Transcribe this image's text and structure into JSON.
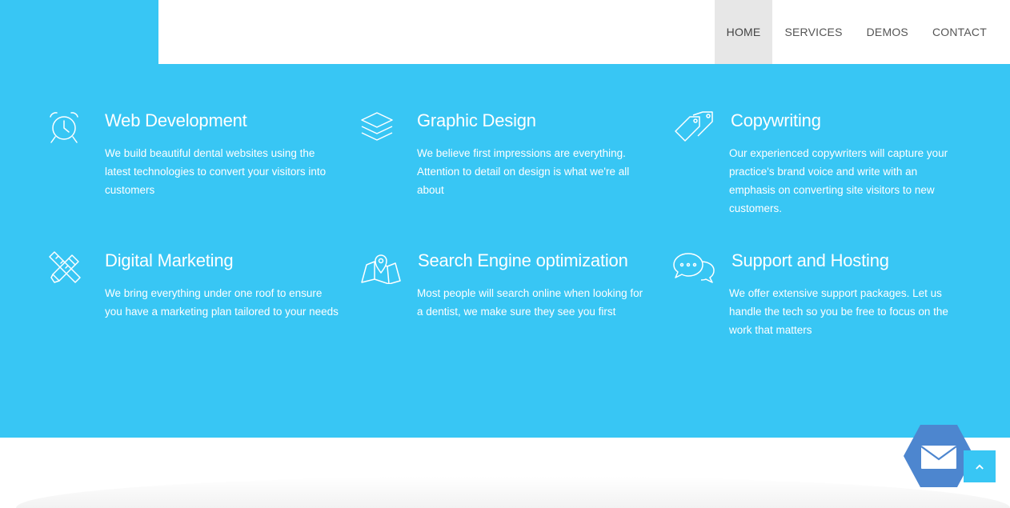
{
  "colors": {
    "accent": "#38c6f4",
    "nav_active_bg": "#e7e7e7",
    "mail_button": "#4d86cf"
  },
  "nav": {
    "items": [
      {
        "label": "HOME",
        "active": true
      },
      {
        "label": "SERVICES",
        "active": false
      },
      {
        "label": "DEMOS",
        "active": false
      },
      {
        "label": "CONTACT",
        "active": false
      }
    ]
  },
  "services": [
    {
      "icon": "alarm-clock-icon",
      "title": "Web Development",
      "text": "We build beautiful dental websites using the latest technologies to convert your visitors into customers"
    },
    {
      "icon": "layers-icon",
      "title": "Graphic Design",
      "text": "We believe first impressions are everything. Attention to detail on design is what we're all about"
    },
    {
      "icon": "price-tags-icon",
      "title": "Copywriting",
      "text": "Our experienced copywriters will capture your practice's brand voice and write with an emphasis on converting site visitors to new customers."
    },
    {
      "icon": "pencil-ruler-icon",
      "title": "Digital Marketing",
      "text": "We bring everything under one roof to ensure you have a marketing plan tailored to your needs"
    },
    {
      "icon": "map-pin-icon",
      "title": "Search Engine optimization",
      "text": "Most people will search online when looking for a dentist, we make sure they see you first"
    },
    {
      "icon": "chat-bubbles-icon",
      "title": "Support and Hosting",
      "text": "We offer extensive support packages. Let us handle the tech so you be free to focus on the work that matters"
    }
  ],
  "widgets": {
    "mail_icon": "envelope-icon",
    "scroll_icon": "chevron-up-icon"
  }
}
